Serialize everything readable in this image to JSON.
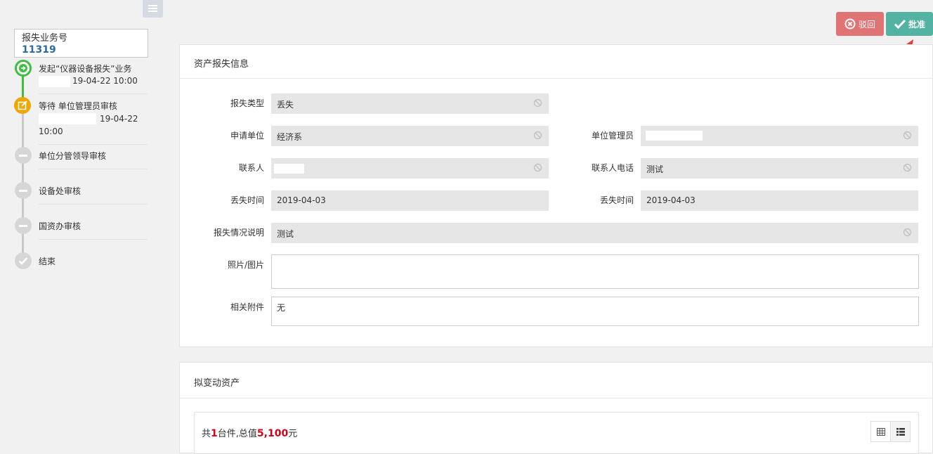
{
  "sidebar": {
    "business_label": "报失业务号",
    "business_number": "11319",
    "steps": [
      {
        "title": "发起“仪器设备报失”业务",
        "time": "19-04-22 10:00",
        "status": "done"
      },
      {
        "title": "等待 单位管理员审核",
        "time": "19-04-22",
        "time2": "10:00",
        "status": "current"
      },
      {
        "title": "单位分管领导审核",
        "status": "pending"
      },
      {
        "title": "设备处审核",
        "status": "pending"
      },
      {
        "title": "国资办审核",
        "status": "pending"
      },
      {
        "title": "结束",
        "status": "end"
      }
    ]
  },
  "toolbar": {
    "recall_label": "驳回",
    "approve_label": "批准"
  },
  "loss_info": {
    "title": "资产报失信息",
    "loss_type_label": "报失类型",
    "loss_type_value": "丢失",
    "apply_unit_label": "申请单位",
    "apply_unit_value": "经济系",
    "unit_admin_label": "单位管理员",
    "unit_admin_value": "",
    "contact_label": "联系人",
    "contact_value": "",
    "contact_phone_label": "联系人电话",
    "contact_phone_value": "测试",
    "loss_time_label": "丢失时间",
    "loss_time_value": "2019-04-03",
    "loss_time2_label": "丢失时间",
    "loss_time2_value": "2019-04-03",
    "desc_label": "报失情况说明",
    "desc_value": "测试",
    "photo_label": "照片/图片",
    "attach_label": "相关附件",
    "attach_value": "无"
  },
  "assets": {
    "title": "拟变动资产",
    "summary_prefix": "共",
    "count": "1",
    "summary_mid": "台件,总值",
    "total": "5,100",
    "summary_suffix": "元"
  },
  "colors": {
    "done": "#3fbf3f",
    "current": "#f0a500",
    "pending": "#c8c8c8",
    "recall": "#e07474",
    "approve": "#52b3a3",
    "number": "#2c6aa0",
    "highlight": "#d0021b"
  }
}
